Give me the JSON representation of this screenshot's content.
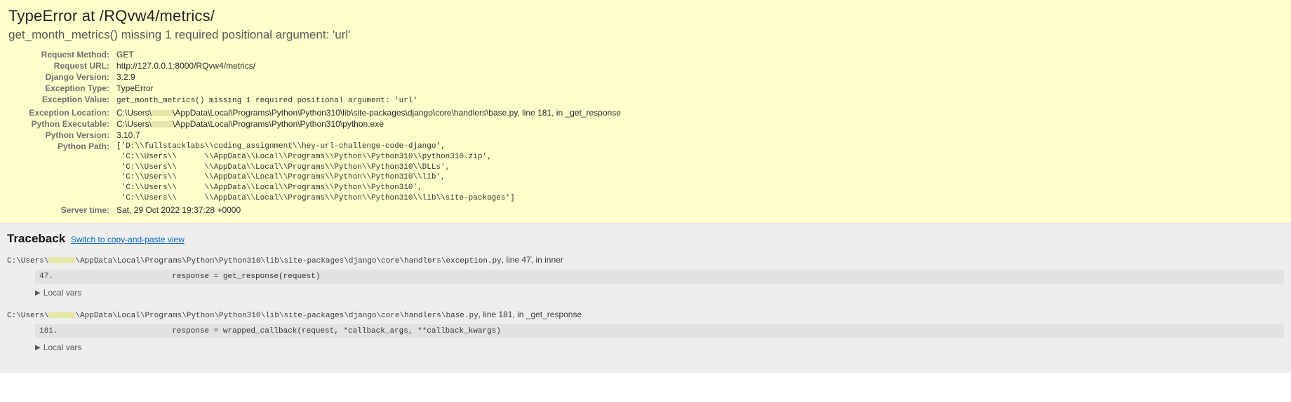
{
  "summary": {
    "heading_pre": "TypeError at ",
    "heading_path": "/RQvw4/metrics/",
    "subtitle": "get_month_metrics() missing 1 required positional argument: 'url'"
  },
  "meta": {
    "request_method_label": "Request Method:",
    "request_method": "GET",
    "request_url_label": "Request URL:",
    "request_url": "http://127.0.0.1:8000/RQvw4/metrics/",
    "django_version_label": "Django Version:",
    "django_version": "3.2.9",
    "exception_type_label": "Exception Type:",
    "exception_type": "TypeError",
    "exception_value_label": "Exception Value:",
    "exception_value": "get_month_metrics() missing 1 required positional argument: 'url'",
    "exception_location_label": "Exception Location:",
    "exception_location_pre": "C:\\Users\\",
    "exception_location_post": "\\AppData\\Local\\Programs\\Python\\Python310\\lib\\site-packages\\django\\core\\handlers\\base.py, line 181, in _get_response",
    "python_exe_label": "Python Executable:",
    "python_exe_pre": "C:\\Users\\",
    "python_exe_post": "\\AppData\\Local\\Programs\\Python\\Python310\\python.exe",
    "python_version_label": "Python Version:",
    "python_version": "3.10.7",
    "python_path_label": "Python Path:",
    "python_path": "['D:\\\\fullstacklabs\\\\coding_assignment\\\\hey-url-challenge-code-django',\n 'C:\\\\Users\\\\      \\\\AppData\\\\Local\\\\Programs\\\\Python\\\\Python310\\\\python310.zip',\n 'C:\\\\Users\\\\      \\\\AppData\\\\Local\\\\Programs\\\\Python\\\\Python310\\\\DLLs',\n 'C:\\\\Users\\\\      \\\\AppData\\\\Local\\\\Programs\\\\Python\\\\Python310\\\\lib',\n 'C:\\\\Users\\\\      \\\\AppData\\\\Local\\\\Programs\\\\Python\\\\Python310',\n 'C:\\\\Users\\\\      \\\\AppData\\\\Local\\\\Programs\\\\Python\\\\Python310\\\\lib\\\\site-packages']",
    "server_time_label": "Server time:",
    "server_time": "Sat, 29 Oct 2022 19:37:28 +0000"
  },
  "traceback": {
    "title": "Traceback",
    "switch_label": "Switch to copy-and-paste view",
    "local_vars_label": "Local vars",
    "frames": [
      {
        "path_pre": "C:\\Users\\",
        "path_post": "\\AppData\\Local\\Programs\\Python\\Python310\\lib\\site-packages\\django\\core\\handlers\\exception.py",
        "tail": ", line 47, in inner",
        "lineno": "47.",
        "src": "            response = get_response(request)"
      },
      {
        "path_pre": "C:\\Users\\",
        "path_post": "\\AppData\\Local\\Programs\\Python\\Python310\\lib\\site-packages\\django\\core\\handlers\\base.py",
        "tail": ", line 181, in _get_response",
        "lineno": "181.",
        "src": "            response = wrapped_callback(request, *callback_args, **callback_kwargs)"
      }
    ]
  }
}
